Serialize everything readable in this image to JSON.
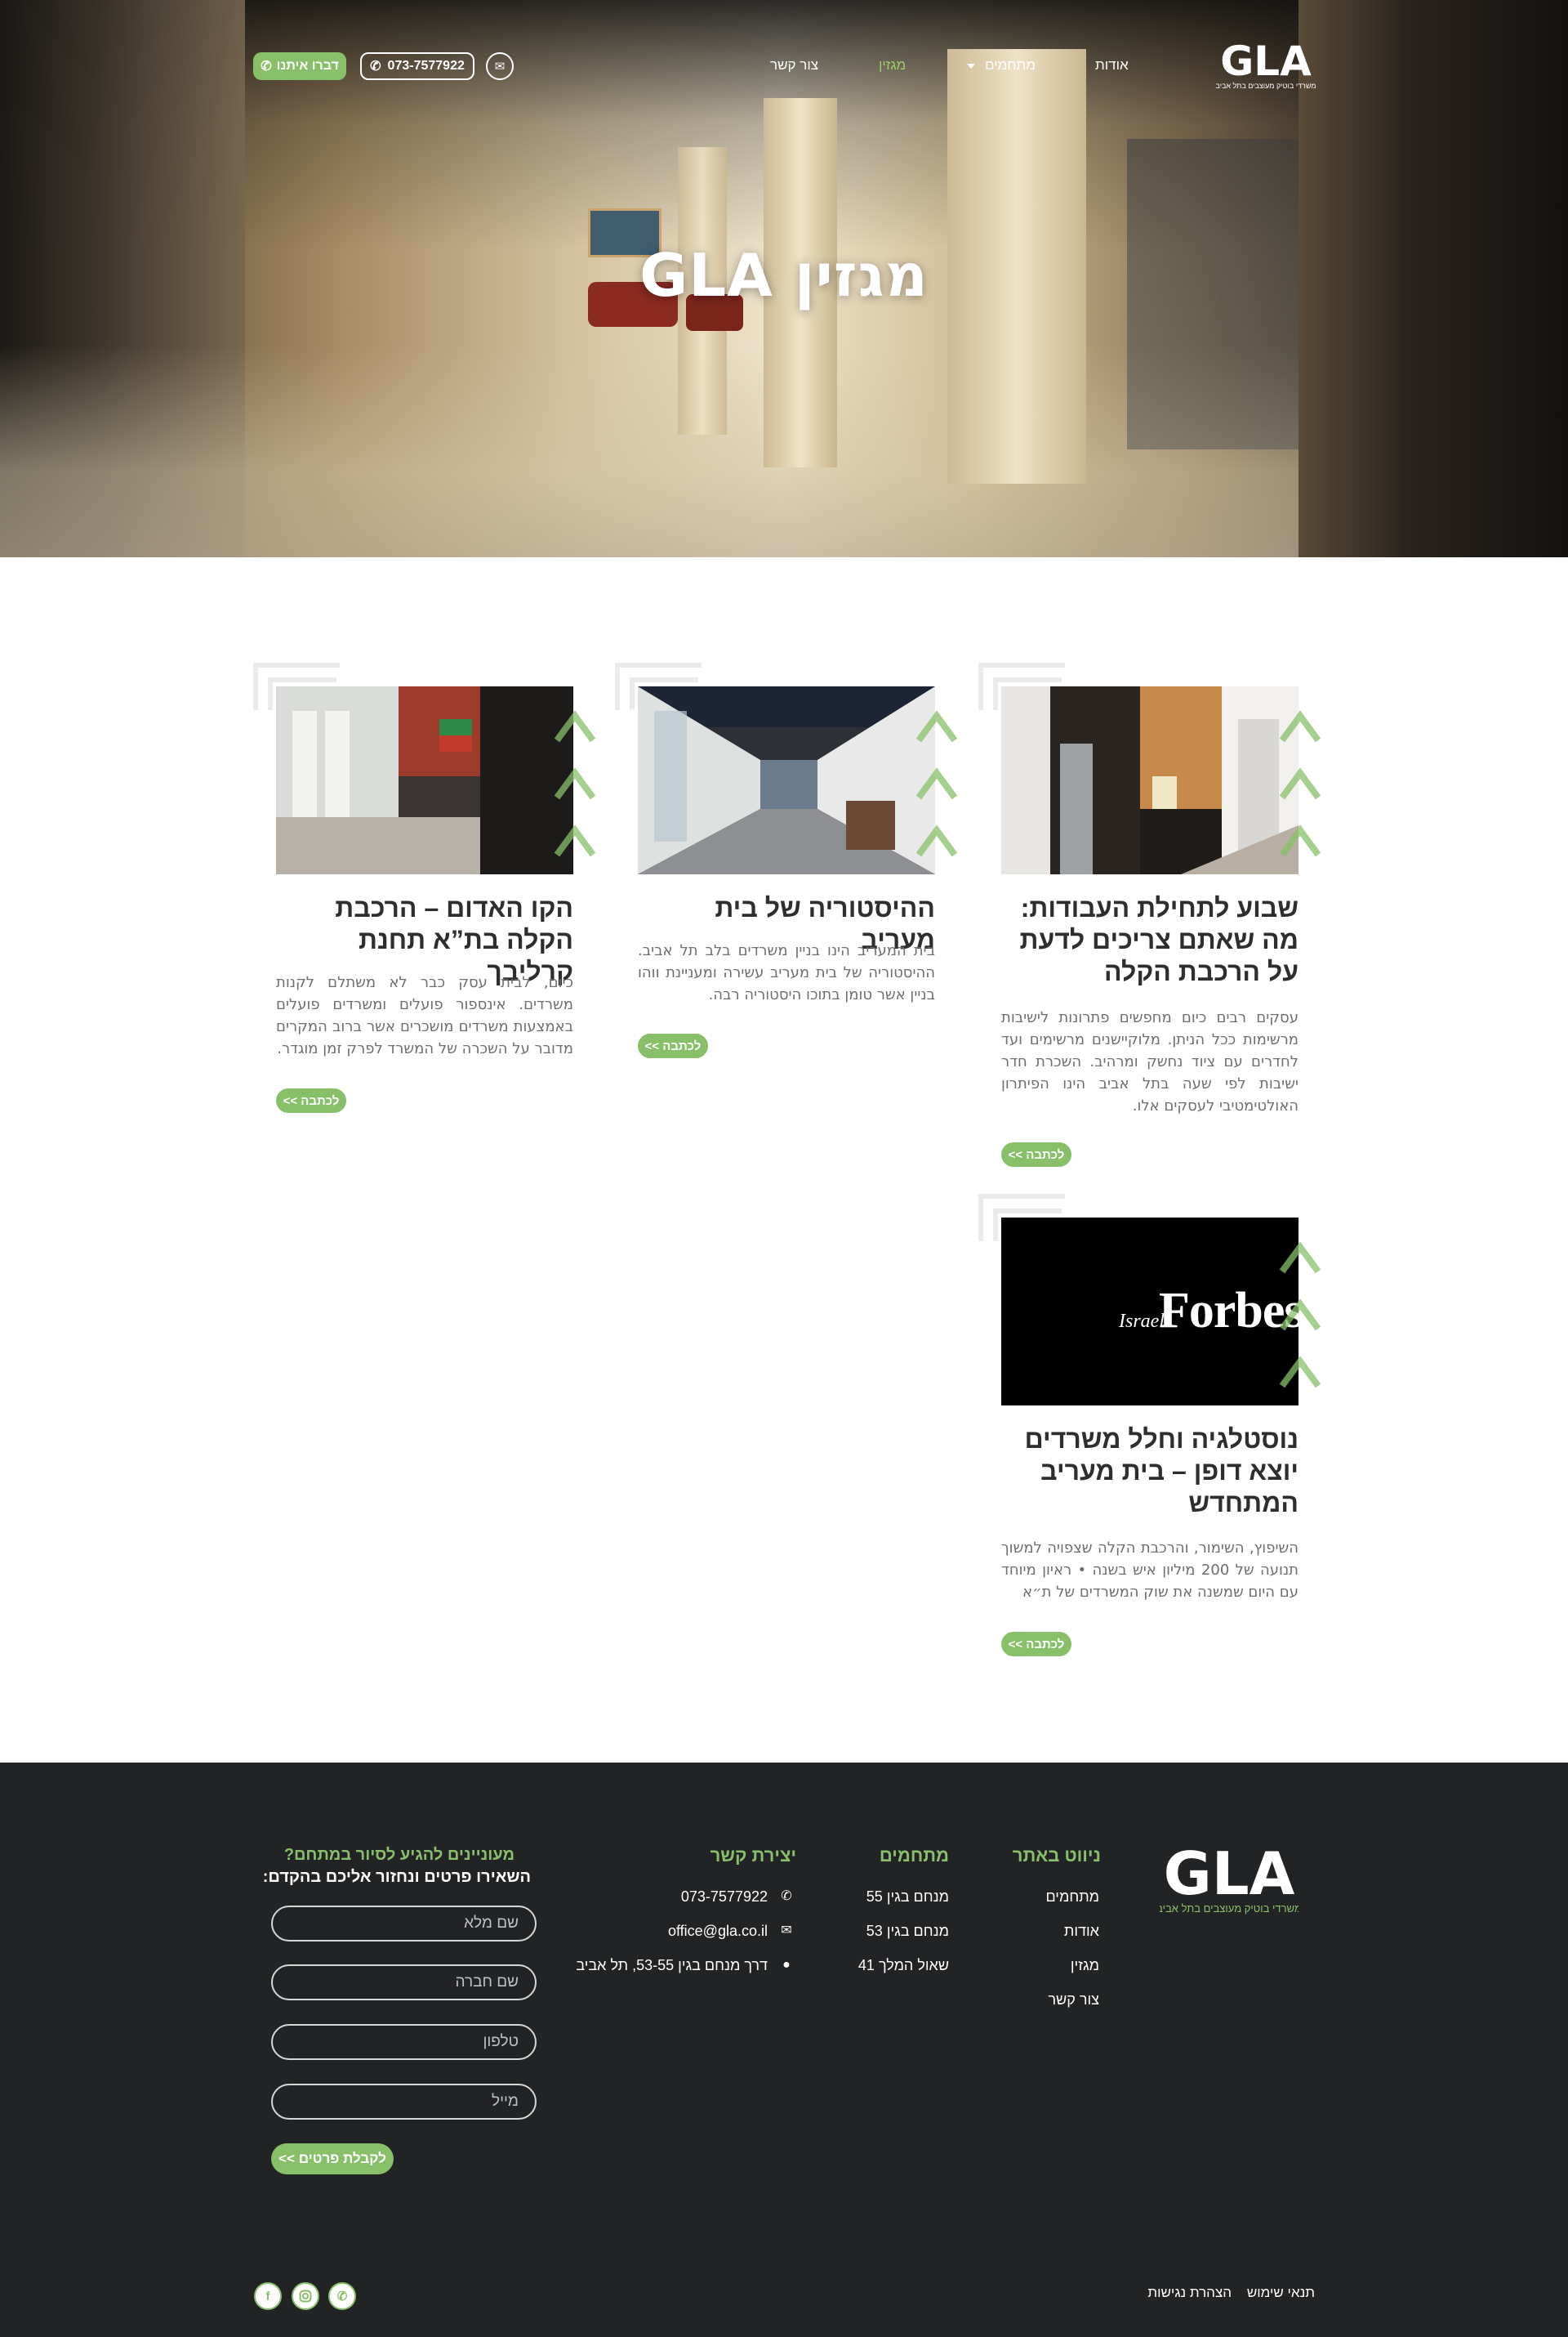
{
  "header": {
    "logo_text": "GLA",
    "logo_tagline": "משרדי בוטיק מעוצבים בתל אביב",
    "nav": [
      {
        "label": "אודות"
      },
      {
        "label": "מתחמים"
      },
      {
        "label": "מגזין"
      },
      {
        "label": "צור קשר"
      }
    ],
    "phone": "073-7577922",
    "whatsapp_label": "דברו איתנו"
  },
  "hero": {
    "title": "מגזין GLA"
  },
  "articles": [
    {
      "title": "שבוע לתחילת העבודות: מה שאתם צריכים לדעת על הרכבת הקלה",
      "excerpt": "עסקים רבים כיום מחפשים פתרונות לישיבות מרשימות ככל הניתן. מלוקיישנים מרשימים ועד לחדרים עם ציוד נחשק ומרהיב. השכרת חדר ישיבות לפי שעה בתל אביב הינו הפיתרון האולטימטיבי לעסקים אלו.",
      "more": "לכתבה >>"
    },
    {
      "title": "ההיסטוריה של בית מעריב",
      "excerpt": "בית המעריב הינו בניין משרדים בלב תל אביב. ההיסטוריה של בית מעריב עשירה ומעניינת ווהו בניין אשר טומן בתוכו היסטוריה רבה.",
      "more": "לכתבה >>"
    },
    {
      "title": "הקו האדום – הרכבת הקלה בת”א תחנת קרליבך",
      "excerpt": "כיום, לבית עסק כבר לא משתלם לקנות משרדים. אינספור פועלים ומשרדים פועלים באמצעות משרדים מושכרים אשר ברוב המקרים מדובר על השכרה של המשרד לפרק זמן מוגדר.",
      "more": "לכתבה >>"
    },
    {
      "title": "נוסטלגיה וחלל משרדים יוצא דופן – בית מעריב המתחדש",
      "excerpt": "השיפוץ, השימור, והרכבת הקלה שצפויה למשוך תנועה של 200 מיליון איש בשנה • ראיון מיוחד עם היום שמשנה את שוק המשרדים של ת״א",
      "more": "לכתבה >>",
      "image_text": "Forbes",
      "image_subtext": "Israel"
    }
  ],
  "footer": {
    "logo_text": "GLA",
    "logo_tagline": "משרדי בוטיק מעוצבים בתל אביב",
    "site_nav": {
      "title": "ניווט באתר",
      "links": [
        "מתחמים",
        "אודות",
        "מגזין",
        "צור קשר"
      ]
    },
    "complexes": {
      "title": "מתחמים",
      "links": [
        "מנחם בגין 55",
        "מנחם בגין 53",
        "שאול המלך 41"
      ]
    },
    "contact": {
      "title": "יצירת קשר",
      "phone": "073-7577922",
      "email": "office@gla.co.il",
      "address": "דרך מנחם בגין 53-55, תל אביב"
    },
    "form": {
      "title": "מעוניינים להגיע לסיור במתחם?",
      "subtitle": "השאירו פרטים ונחזור אליכם בהקדם:",
      "fields": [
        {
          "placeholder": "שם מלא"
        },
        {
          "placeholder": "שם חברה"
        },
        {
          "placeholder": "טלפון"
        },
        {
          "placeholder": "מייל"
        }
      ],
      "submit": "לקבלת פרטים >>"
    },
    "bottom": {
      "terms": "תנאי שימוש",
      "accessibility": "הצהרת נגישות"
    }
  },
  "colors": {
    "accent": "#88c06a",
    "footer_bg": "#212325",
    "title": "#2c2e30"
  }
}
